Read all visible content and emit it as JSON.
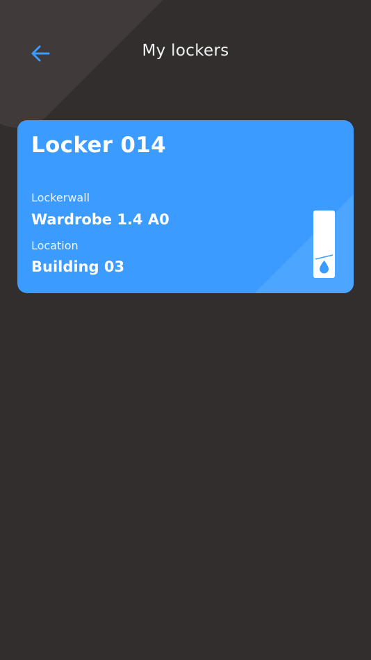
{
  "header": {
    "title": "My lockers",
    "back_icon": "arrow-left-icon",
    "accent_color": "#3b9bff"
  },
  "lockers": [
    {
      "name": "Locker 014",
      "lockerwall_label": "Lockerwall",
      "lockerwall_value": "Wardrobe 1.4 A0",
      "location_label": "Location",
      "location_value": "Building 03",
      "icon": "locker-door-icon"
    }
  ],
  "colors": {
    "background": "#322e2e",
    "card": "#3b9bff",
    "text": "#ffffff"
  }
}
